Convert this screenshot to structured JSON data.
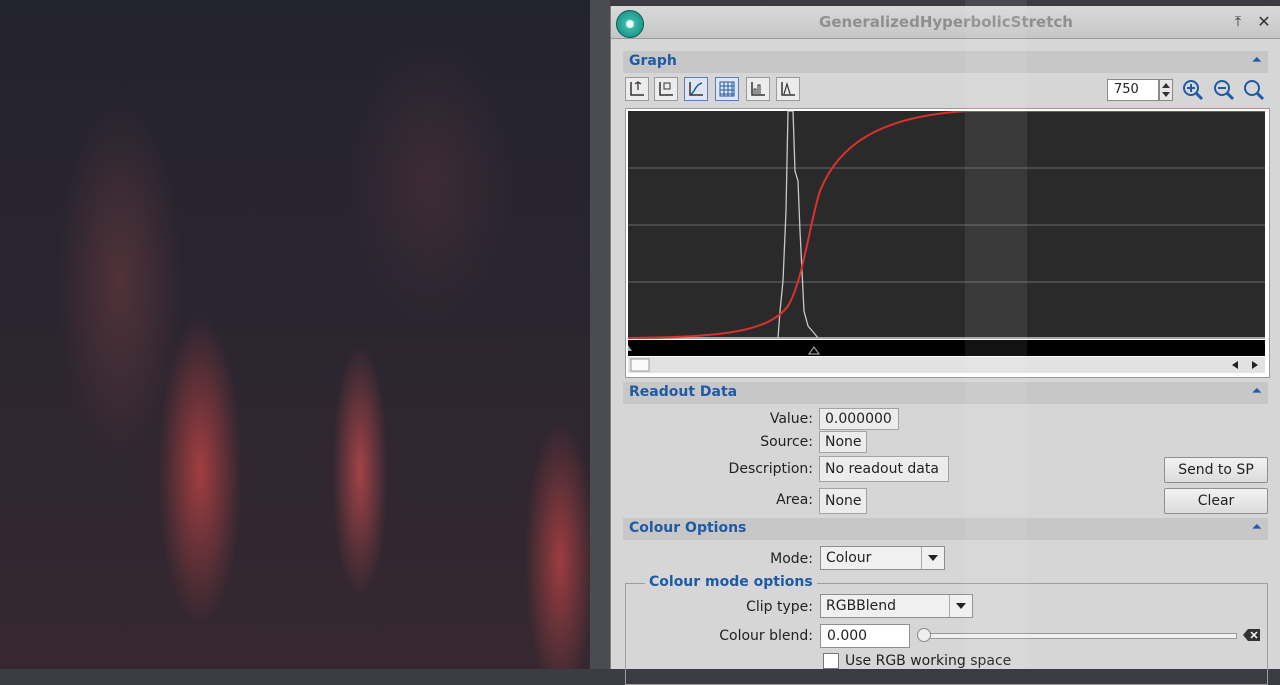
{
  "window": {
    "title": "GeneralizedHyperbolicStretch"
  },
  "graph": {
    "section_label": "Graph",
    "zoom_value": "750"
  },
  "readout": {
    "section_label": "Readout Data",
    "value_label": "Value:",
    "value": "0.000000",
    "source_label": "Source:",
    "source": "None",
    "description_label": "Description:",
    "description": "No readout data",
    "area_label": "Area:",
    "area": "None",
    "send_button": "Send to SP",
    "clear_button": "Clear"
  },
  "colour_options": {
    "section_label": "Colour Options",
    "mode_label": "Mode:",
    "mode_value": "Colour",
    "group_title": "Colour mode options",
    "clip_label": "Clip type:",
    "clip_value": "RGBBlend",
    "blend_label": "Colour blend:",
    "blend_value": "0.000",
    "blend_slider_fraction": 0.0,
    "rgb_checkbox_label": "Use RGB working space",
    "rgb_checked": false
  },
  "colors": {
    "accent": "#1e5aa6",
    "curve": "#d8322e",
    "graph_bg": "#2a2a2a"
  },
  "icons": [
    "pin-icon",
    "close-icon",
    "collapse-icon",
    "zoom-in-icon",
    "zoom-out-icon",
    "zoom-fit-icon",
    "scroll-left-icon",
    "scroll-right-icon",
    "reset-icon"
  ]
}
